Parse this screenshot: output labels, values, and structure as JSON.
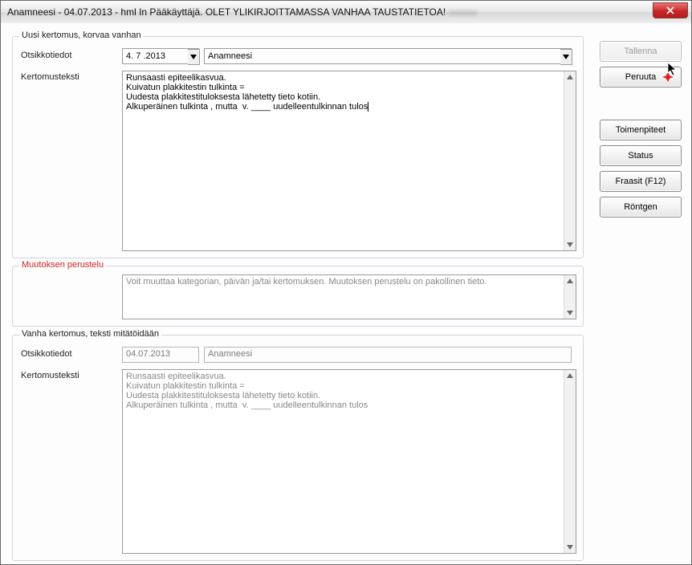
{
  "titlebar": {
    "prefix": "Anamneesi  -  04.07.2013  -  hml In Pääkäyttäjä. ",
    "warning": "OLET YLIKIRJOITTAMASSA VANHAA TAUSTATIETOA!",
    "blurred_tail": "———"
  },
  "groups": {
    "uusi": "Uusi kertomus, korvaa vanhan",
    "muutos": "Muutoksen perustelu",
    "vanha": "Vanha kertomus, teksti mitätöidään"
  },
  "labels": {
    "otsikkotiedot": "Otsikkotiedot",
    "kertomusteksti": "Kertomusteksti"
  },
  "uusi": {
    "date": "4. 7 .2013",
    "category": "Anamneesi",
    "text": "Runsaasti epiteelikasvua.\nKuivatun plakkitestin tulkinta =\nUudesta plakkitestituloksesta lähetetty tieto kotiin.\nAlkuperäinen tulkinta , mutta  v. ____ uudelleentulkinnan tulos"
  },
  "muutos": {
    "placeholder": "Voit muuttaa kategorian, päivän ja/tai kertomuksen. Muutoksen perustelu on pakollinen tieto."
  },
  "vanha": {
    "date": "04.07.2013",
    "category": "Anamneesi",
    "text": "Runsaasti epiteelikasvua.\nKuivatun plakkitestin tulkinta =\nUudesta plakkitestituloksesta lähetetty tieto kotiin.\nAlkuperäinen tulkinta , mutta  v. ____ uudelleentulkinnan tulos"
  },
  "buttons": {
    "tallenna": "Tallenna",
    "peruuta": "Peruuta",
    "toimenpiteet": "Toimenpiteet",
    "status": "Status",
    "fraasit": "Fraasit (F12)",
    "rontgen": "Röntgen"
  }
}
